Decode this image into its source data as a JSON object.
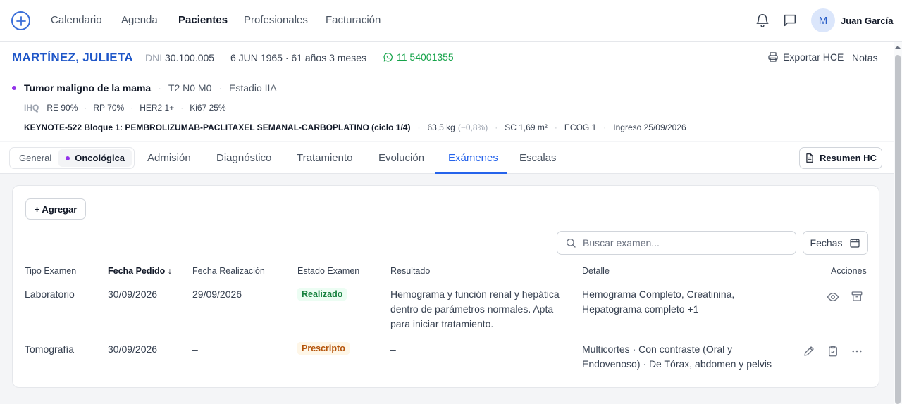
{
  "nav": {
    "links": [
      "Calendario",
      "Agenda",
      "Pacientes",
      "Profesionales",
      "Facturación"
    ],
    "active": "Pacientes",
    "avatar_initial": "M",
    "user_name": "Juan García"
  },
  "patient": {
    "name": "MARTÍNEZ, JULIETA",
    "dni_label": "DNI",
    "dni": "30.100.005",
    "dob_age": "6 JUN 1965 · 61 años 3 meses",
    "phone": "11 54001355",
    "export_label": "Exportar HCE",
    "notes_label": "Notas",
    "diagnosis": "Tumor maligno de la mama",
    "tnm": "T2 N0 M0",
    "stage": "Estadio IIA",
    "ihq_label": "IHQ",
    "ihq": [
      "RE 90%",
      "RP 70%",
      "HER2 1+",
      "Ki67 25%"
    ],
    "regimen": "KEYNOTE-522 Bloque 1: PEMBROLIZUMAB-PACLITAXEL SEMANAL-CARBOPLATINO (ciclo 1/4)",
    "weight": "63,5 kg",
    "weight_change": "(−0,8%)",
    "sc": "SC 1,69 m²",
    "ecog": "ECOG 1",
    "ingreso": "Ingreso 25/09/2026"
  },
  "tabs": {
    "segment": [
      "General",
      "Oncológica"
    ],
    "segment_active": "Oncológica",
    "items": [
      "Admisión",
      "Diagnóstico",
      "Tratamiento",
      "Evolución",
      "Exámenes",
      "Escalas"
    ],
    "active": "Exámenes",
    "resumen_label": "Resumen HC"
  },
  "exams": {
    "add_label": "+ Agregar",
    "search_placeholder": "Buscar examen...",
    "dates_label": "Fechas",
    "columns": [
      "Tipo Examen",
      "Fecha Pedido",
      "Fecha Realización",
      "Estado Examen",
      "Resultado",
      "Detalle",
      "Acciones"
    ],
    "sort_indicator": "↓",
    "rows": [
      {
        "tipo": "Laboratorio",
        "pedido": "30/09/2026",
        "realizacion": "29/09/2026",
        "estado": "Realizado",
        "resultado": [
          "Hemograma y función renal y hepática",
          "dentro de parámetros normales. Apta",
          "para iniciar tratamiento."
        ],
        "detalle": [
          "Hemograma Completo, Creatinina,",
          "Hepatograma completo +1"
        ],
        "actions": [
          "eye-icon",
          "archive-icon"
        ]
      },
      {
        "tipo": "Tomografía",
        "pedido": "30/09/2026",
        "realizacion": "–",
        "estado": "Prescripto",
        "resultado": [
          "–"
        ],
        "detalle": [
          "Multicortes · Con contraste (Oral y",
          "Endovenoso) · De Tórax, abdomen y pelvis"
        ],
        "actions": [
          "pencil-icon",
          "clipboard-check-icon",
          "more-icon"
        ]
      }
    ]
  },
  "colors": {
    "brand": "#1e56c8",
    "active_tab": "#2563eb",
    "oncology_dot": "#9333ea",
    "phone": "#16a34a",
    "done": "#15803d",
    "prescribed": "#b45309"
  }
}
